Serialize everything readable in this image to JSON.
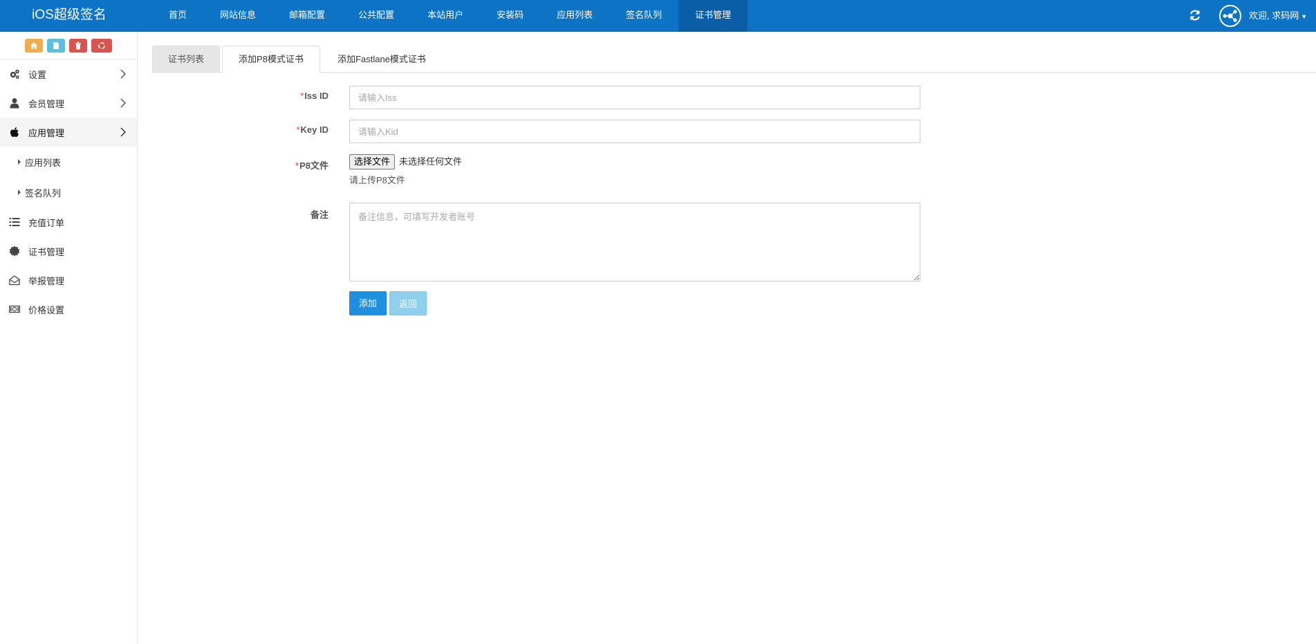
{
  "header": {
    "brand": "iOS超级签名",
    "nav": [
      {
        "label": "首页"
      },
      {
        "label": "网站信息"
      },
      {
        "label": "邮箱配置"
      },
      {
        "label": "公共配置"
      },
      {
        "label": "本站用户"
      },
      {
        "label": "安装码"
      },
      {
        "label": "应用列表"
      },
      {
        "label": "签名队列"
      },
      {
        "label": "证书管理"
      }
    ],
    "active_nav": "证书管理",
    "welcome": "欢迎, 求码网",
    "colors": {
      "bar": "#0d73c4",
      "active": "#0a5ea8"
    }
  },
  "sidebar": {
    "shortcuts": [
      {
        "icon": "home-icon",
        "color": "#f0ad4e"
      },
      {
        "icon": "file-icon",
        "color": "#5bc0de"
      },
      {
        "icon": "trash-icon",
        "color": "#d9534f"
      },
      {
        "icon": "recycle-icon",
        "color": "#d9534f"
      }
    ],
    "items": [
      {
        "label": "设置",
        "icon": "gears-icon"
      },
      {
        "label": "会员管理",
        "icon": "user-icon"
      },
      {
        "label": "应用管理",
        "icon": "apple-icon"
      },
      {
        "label": "应用列表"
      },
      {
        "label": "签名队列"
      },
      {
        "label": "充值订单",
        "icon": "list-icon"
      },
      {
        "label": "证书管理",
        "icon": "certificate-icon"
      },
      {
        "label": "举报管理",
        "icon": "envelope-open-icon"
      },
      {
        "label": "价格设置",
        "icon": "money-icon"
      }
    ]
  },
  "tabs": [
    {
      "label": "证书列表"
    },
    {
      "label": "添加P8模式证书"
    },
    {
      "label": "添加Fastlane模式证书"
    }
  ],
  "form": {
    "required_mark": "*",
    "iss": {
      "label": "Iss ID",
      "placeholder": "请输入Iss",
      "value": ""
    },
    "kid": {
      "label": "Key ID",
      "placeholder": "请输入Kid",
      "value": ""
    },
    "p8": {
      "label": "P8文件",
      "button": "选择文件",
      "status": "未选择任何文件",
      "help": "请上传P8文件"
    },
    "remark": {
      "label": "备注",
      "placeholder": "备注信息，可填写开发者账号"
    },
    "submit": "添加",
    "back": "返回"
  }
}
